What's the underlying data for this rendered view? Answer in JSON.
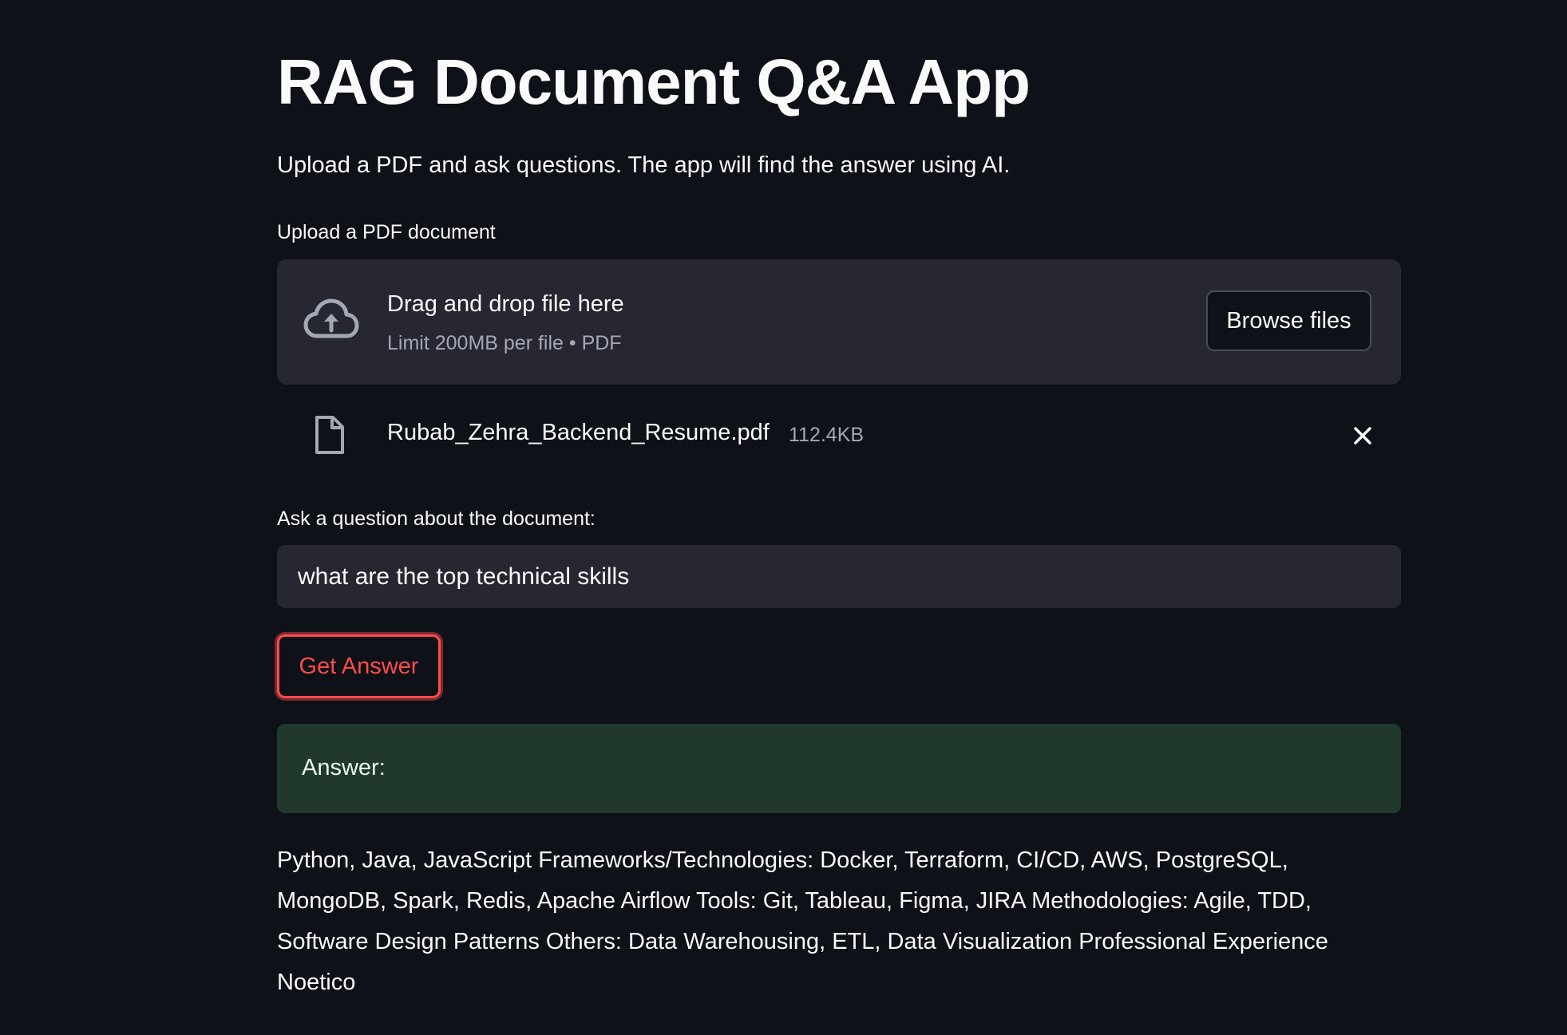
{
  "page": {
    "title": "RAG Document Q&A App",
    "subtitle": "Upload a PDF and ask questions. The app will find the answer using AI."
  },
  "uploader": {
    "label": "Upload a PDF document",
    "drop_title": "Drag and drop file here",
    "drop_limit": "Limit 200MB per file • PDF",
    "browse_label": "Browse files",
    "upload_icon": "cloud-upload-icon"
  },
  "uploaded_file": {
    "name": "Rubab_Zehra_Backend_Resume.pdf",
    "size": "112.4KB",
    "file_icon": "file-icon",
    "remove_icon": "close-icon"
  },
  "question": {
    "label": "Ask a question about the document:",
    "value": "what are the top technical skills"
  },
  "submit": {
    "label": "Get Answer"
  },
  "result": {
    "success_label": "Answer:",
    "answer": "Python, Java, JavaScript Frameworks/Technologies: Docker, Terraform, CI/CD, AWS, PostgreSQL, MongoDB, Spark, Redis, Apache Airflow Tools: Git, Tableau, Figma, JIRA Methodologies: Agile, TDD, Software Design Patterns Others: Data Warehousing, ETL, Data Visualization Professional Experience Noetico"
  },
  "colors": {
    "background": "#0e1117",
    "panel": "#262730",
    "accent": "#ff4b4b",
    "success_bg": "#21392c",
    "muted_text": "#a3a8b4"
  }
}
